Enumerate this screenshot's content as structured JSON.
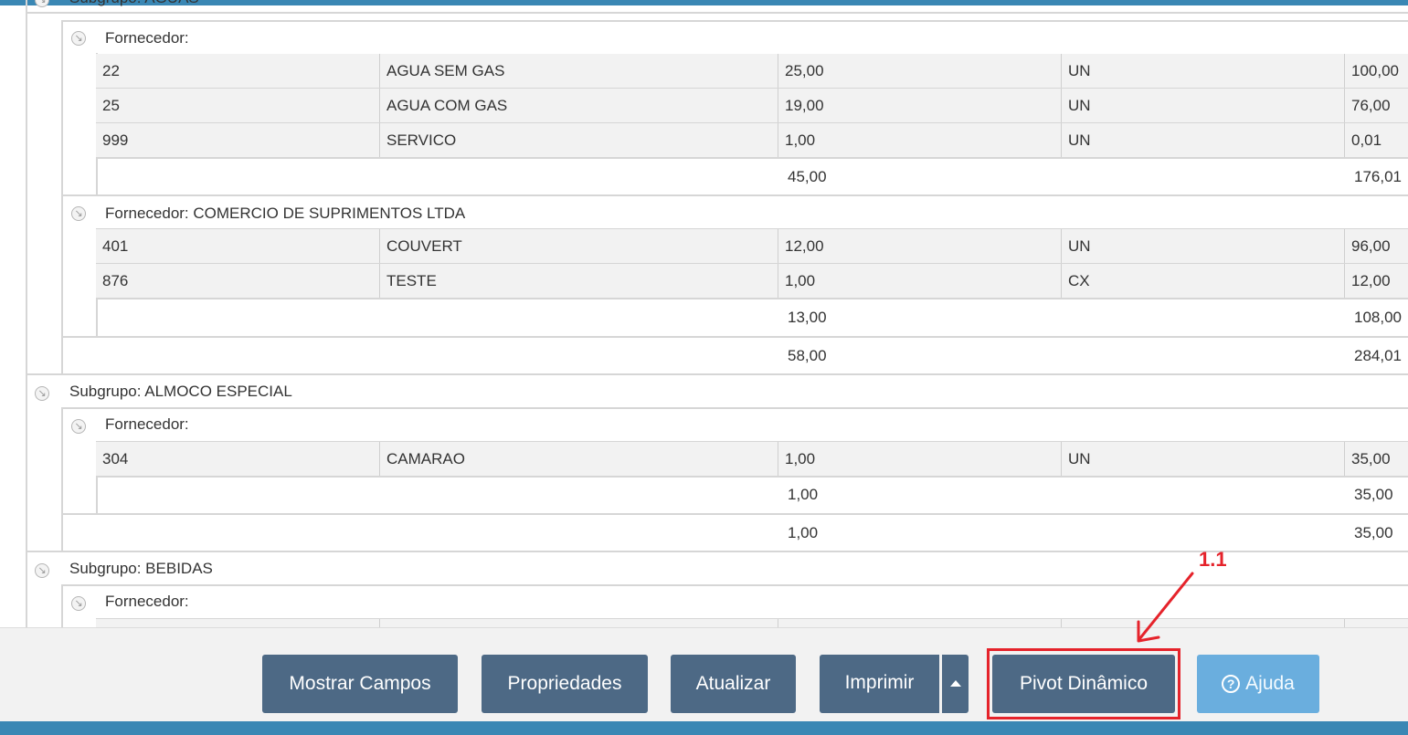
{
  "report": {
    "top_subgroup": "Subgrupo: AGUAS",
    "suppliers": [
      {
        "label": "Fornecedor:",
        "rows": [
          {
            "code": "22",
            "name": "AGUA SEM GAS",
            "qty": "25,00",
            "unit": "UN",
            "total": "100,00"
          },
          {
            "code": "25",
            "name": "AGUA COM GAS",
            "qty": "19,00",
            "unit": "UN",
            "total": "76,00"
          },
          {
            "code": "999",
            "name": "SERVICO",
            "qty": "1,00",
            "unit": "UN",
            "total": "0,01"
          }
        ],
        "sum_qty": "45,00",
        "sum_total": "176,01"
      },
      {
        "label": "Fornecedor: COMERCIO DE SUPRIMENTOS LTDA",
        "rows": [
          {
            "code": "401",
            "name": "COUVERT",
            "qty": "12,00",
            "unit": "UN",
            "total": "96,00"
          },
          {
            "code": "876",
            "name": "TESTE",
            "qty": "1,00",
            "unit": "CX",
            "total": "12,00"
          }
        ],
        "sum_qty": "13,00",
        "sum_total": "108,00"
      }
    ],
    "subgroup_sum_qty": "58,00",
    "subgroup_sum_total": "284,01",
    "subgroup2": {
      "label": "Subgrupo: ALMOCO ESPECIAL",
      "supplier_label": "Fornecedor:",
      "rows": [
        {
          "code": "304",
          "name": "CAMARAO",
          "qty": "1,00",
          "unit": "UN",
          "total": "35,00"
        }
      ],
      "supplier_sum_qty": "1,00",
      "supplier_sum_total": "35,00",
      "sum_qty": "1,00",
      "sum_total": "35,00"
    },
    "subgroup3": {
      "label": "Subgrupo: BEBIDAS",
      "supplier_label": "Fornecedor:"
    }
  },
  "toolbar": {
    "show_fields": "Mostrar Campos",
    "properties": "Propriedades",
    "refresh": "Atualizar",
    "print": "Imprimir",
    "pivot": "Pivot Dinâmico",
    "help": "Ajuda"
  },
  "annotation": {
    "label": "1.1",
    "color": "#e5232b"
  },
  "colors": {
    "accent_bar": "#3a87b4",
    "button": "#4d6985",
    "help_button": "#6aaede"
  }
}
